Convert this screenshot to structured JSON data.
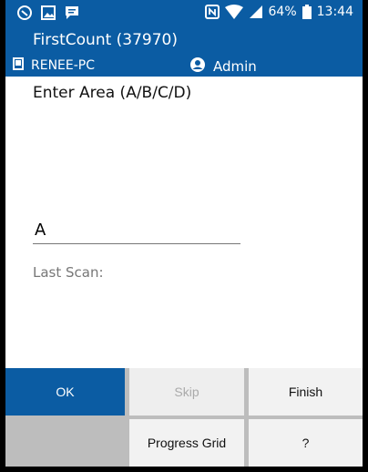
{
  "status_bar": {
    "left_icons": [
      "circle-s-icon",
      "image-icon",
      "message-icon"
    ],
    "right_icons": [
      "nfc-icon",
      "wifi-icon",
      "signal-icon",
      "battery-icon"
    ],
    "battery": "64%",
    "time": "13:44"
  },
  "app": {
    "title": "FirstCount (37970)",
    "device": "RENEE-PC",
    "user": "Admin"
  },
  "screen": {
    "prompt": "Enter Area (A/B/C/D)",
    "input_value": "A",
    "last_scan_label": "Last Scan:"
  },
  "keypad": {
    "ok": "OK",
    "skip": "Skip",
    "finish": "Finish",
    "progress_grid": "Progress Grid",
    "help": "?"
  },
  "colors": {
    "primary": "#0b5ca3",
    "key_light": "#f2f2f2",
    "keypad_bg": "#bdbdbd"
  }
}
